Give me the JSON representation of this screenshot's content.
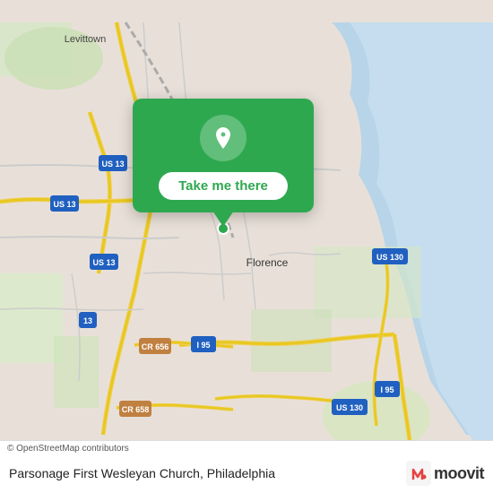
{
  "map": {
    "alt": "Street map of Philadelphia area near Florence, NJ"
  },
  "popup": {
    "icon_name": "location-pin-icon",
    "button_label": "Take me there"
  },
  "bottom_bar": {
    "copyright_text": "© OpenStreetMap contributors",
    "location_name": "Parsonage First Wesleyan Church, Philadelphia",
    "moovit_label": "moovit"
  }
}
